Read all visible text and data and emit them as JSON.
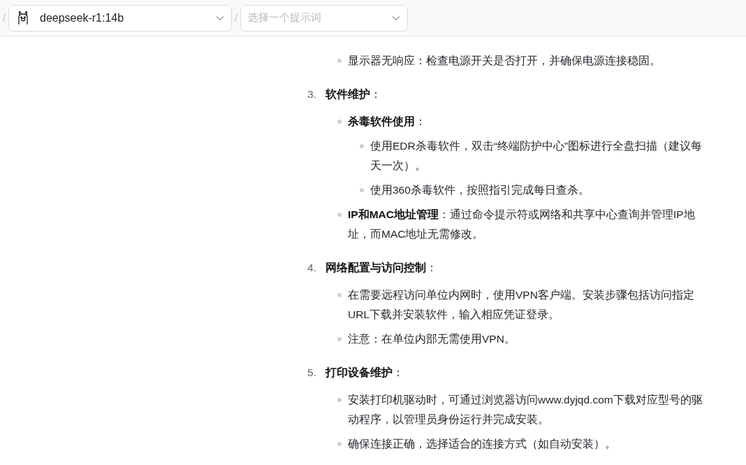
{
  "header": {
    "separators": [
      "/",
      "/"
    ],
    "model_select": {
      "value": "deepseek-r1:14b"
    },
    "prompt_select": {
      "placeholder": "选择一个提示词"
    }
  },
  "content": {
    "leading_items": [
      {
        "text": "显示器无响应：检查电源开关是否打开，并确保电源连接稳固。"
      }
    ],
    "sections": [
      {
        "number": "3.",
        "title": "**软件维护**：",
        "items": [
          {
            "text": "**杀毒软件使用**：",
            "children": [
              {
                "text": "使用EDR杀毒软件，双击“终端防护中心”图标进行全盘扫描（建议每天一次）。"
              },
              {
                "text": "使用360杀毒软件，按照指引完成每日查杀。"
              }
            ]
          },
          {
            "text": "**IP和MAC地址管理**：通过命令提示符或网络和共享中心查询并管理IP地址，而MAC地址无需修改。"
          }
        ]
      },
      {
        "number": "4.",
        "title": "**网络配置与访问控制**：",
        "items": [
          {
            "text": "在需要远程访问单位内网时，使用VPN客户端。安装步骤包括访问指定URL下载并安装软件，输入相应凭证登录。"
          },
          {
            "text": "注意：在单位内部无需使用VPN。"
          }
        ]
      },
      {
        "number": "5.",
        "title": "**打印设备维护**：",
        "items": [
          {
            "text": "安装打印机驱动时，可通过浏览器访问www.dyjqd.com下载对应型号的驱动程序，以管理员身份运行并完成安装。"
          },
          {
            "text": "确保连接正确，选择适合的连接方式（如自动安装）。"
          }
        ]
      }
    ]
  }
}
